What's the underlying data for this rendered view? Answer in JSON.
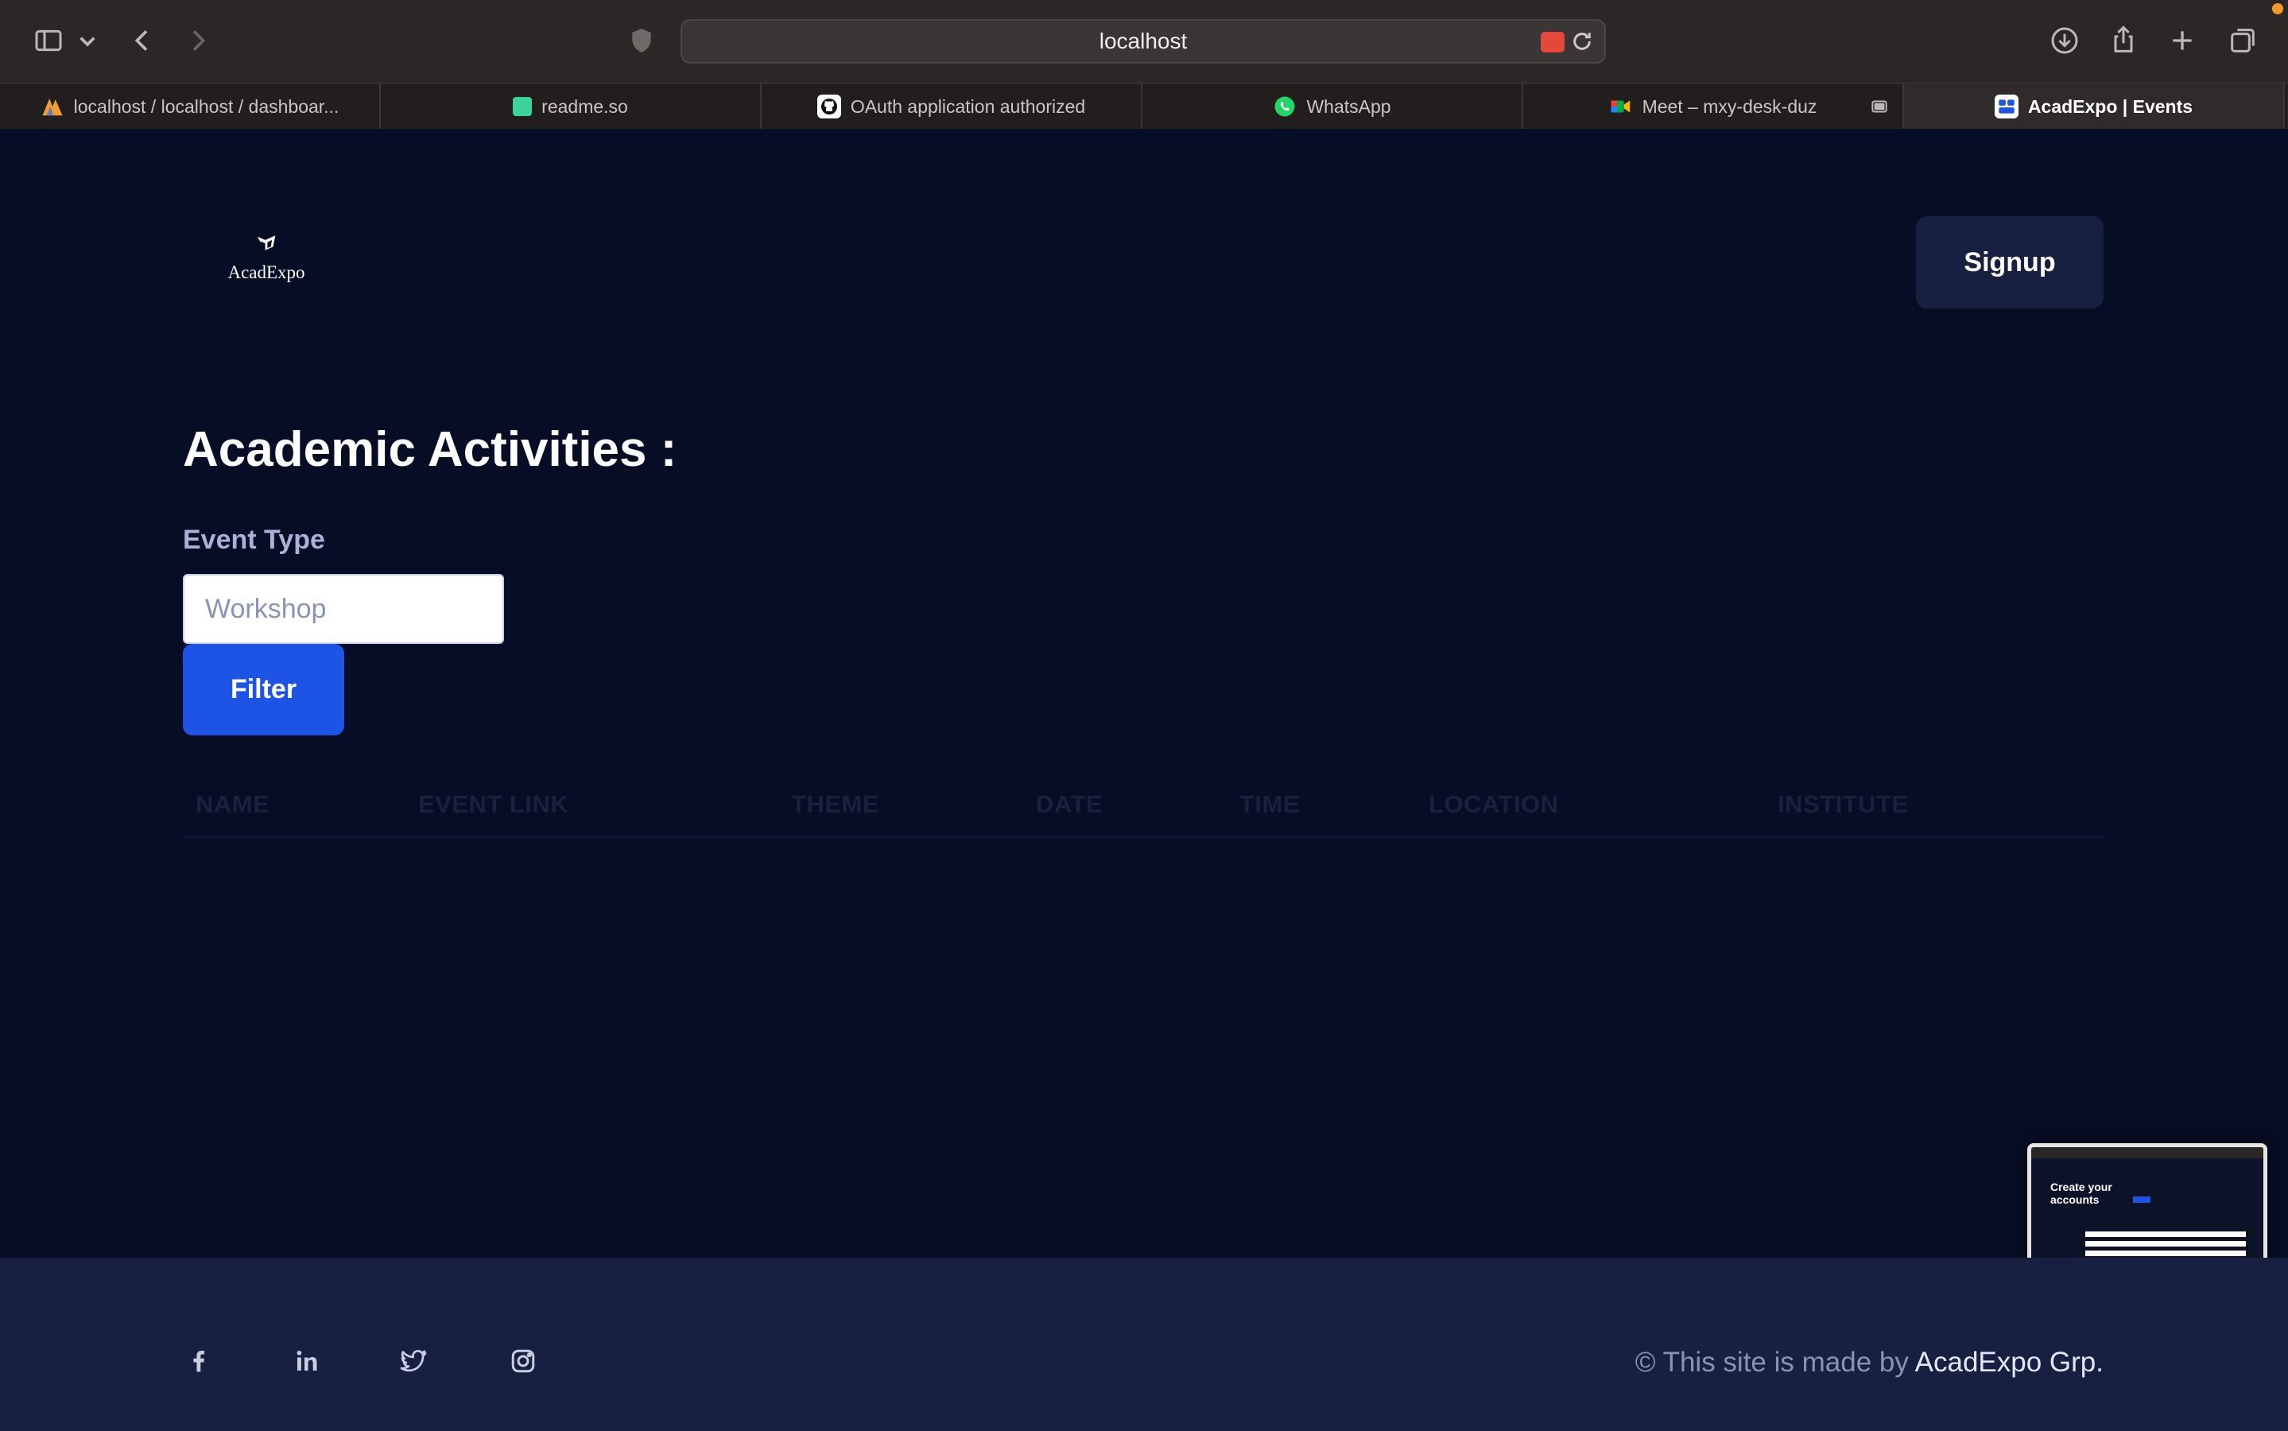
{
  "browser": {
    "url": "localhost",
    "tabs": [
      {
        "title": "localhost / localhost / dashboar...",
        "favicon": "phpmyadmin-icon",
        "active": false
      },
      {
        "title": "readme.so",
        "favicon": "readme-icon",
        "active": false
      },
      {
        "title": "OAuth application authorized",
        "favicon": "github-icon",
        "active": false
      },
      {
        "title": "WhatsApp",
        "favicon": "whatsapp-icon",
        "active": false
      },
      {
        "title": "Meet – mxy-desk-duz",
        "favicon": "google-meet-icon",
        "active": false
      },
      {
        "title": "AcadExpo | Events",
        "favicon": "acadexpo-icon",
        "active": true
      }
    ]
  },
  "header": {
    "logo_text": "AcadExpo",
    "signup_label": "Signup"
  },
  "main": {
    "heading": "Academic Activities :",
    "filter": {
      "label": "Event Type",
      "placeholder": "Workshop",
      "button_label": "Filter"
    },
    "table": {
      "columns": [
        "NAME",
        "EVENT LINK",
        "THEME",
        "DATE",
        "TIME",
        "LOCATION",
        "INSTITUTE"
      ],
      "rows": []
    }
  },
  "thumbnail": {
    "title": "Create your accounts"
  },
  "footer": {
    "social": [
      "facebook-icon",
      "linkedin-icon",
      "twitter-icon",
      "instagram-icon"
    ],
    "copyright_prefix": "© This site is made by",
    "copyright_brand": "AcadExpo Grp."
  },
  "colors": {
    "background": "#070d24",
    "footer": "#172041",
    "accent": "#1e54e6"
  }
}
